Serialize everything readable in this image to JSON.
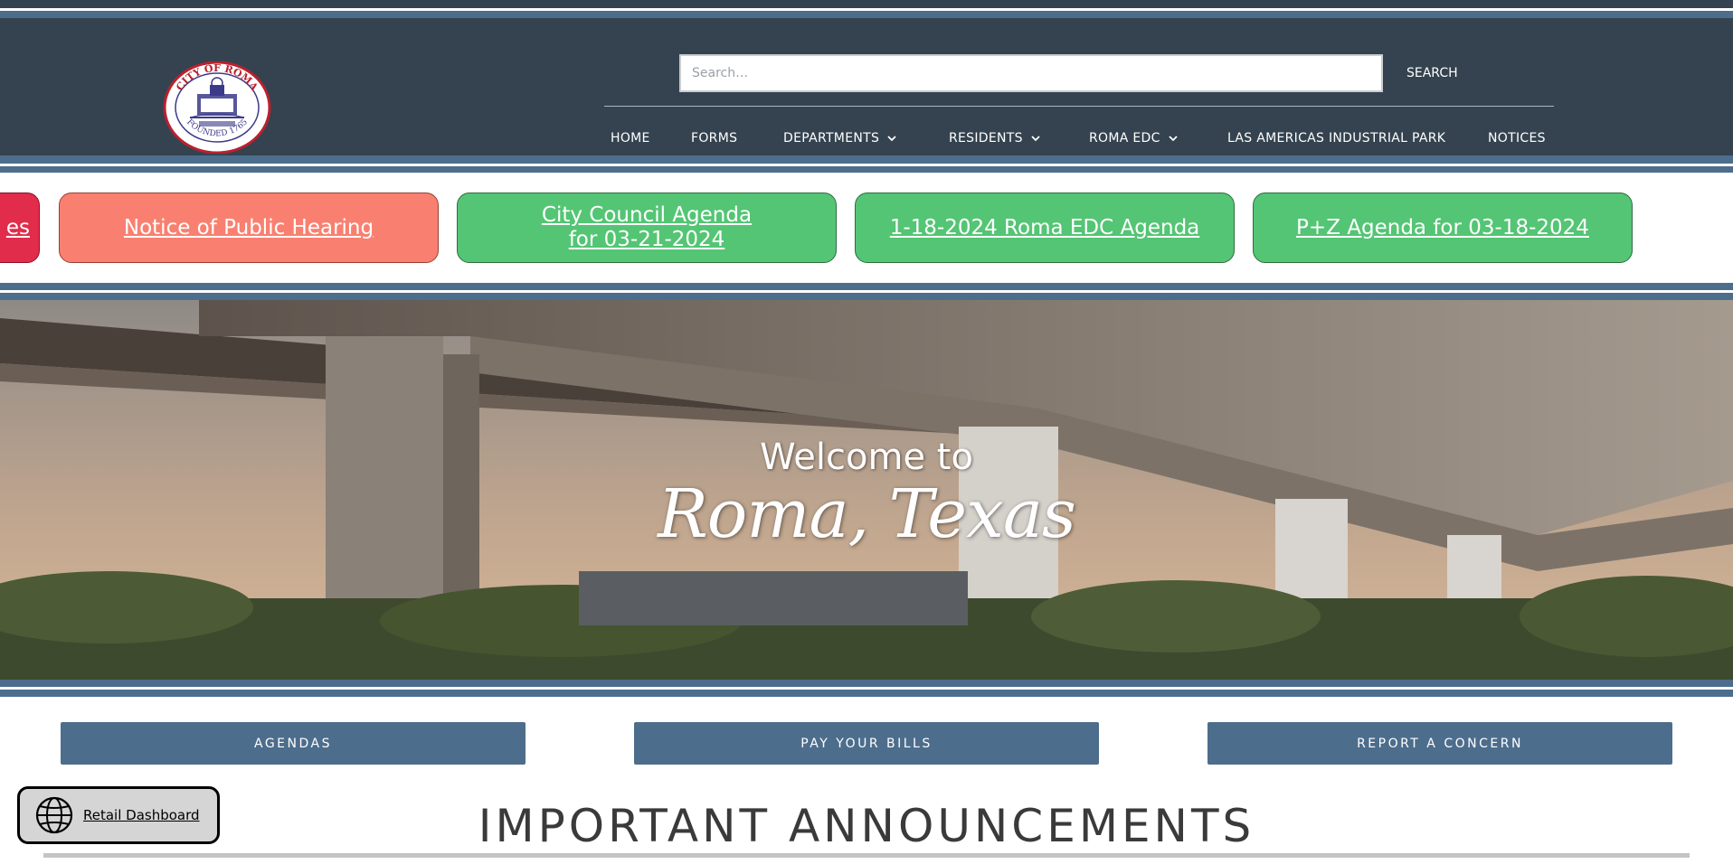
{
  "colors": {
    "header_bg": "#34434f",
    "stripe_blue": "#4d6d8c",
    "notice_red": "#f98070",
    "notice_green": "#54c574",
    "notice_crimson": "#e12c4c",
    "action_button": "#4d6d8c"
  },
  "header": {
    "logo": {
      "text_top": "CITY OF ROMA",
      "text_bottom": "FOUNDED 1765",
      "icon": "city-seal"
    },
    "search": {
      "placeholder": "Search…",
      "value": "",
      "button_label": "SEARCH"
    },
    "nav": [
      {
        "label": "HOME",
        "has_dropdown": false
      },
      {
        "label": "FORMS",
        "has_dropdown": false
      },
      {
        "label": "DEPARTMENTS",
        "has_dropdown": true
      },
      {
        "label": "RESIDENTS",
        "has_dropdown": true
      },
      {
        "label": "ROMA EDC",
        "has_dropdown": true
      },
      {
        "label": "LAS AMERICAS INDUSTRIAL PARK",
        "has_dropdown": false
      },
      {
        "label": "NOTICES",
        "has_dropdown": false
      }
    ]
  },
  "notices": [
    {
      "label": "es",
      "style": "crimson"
    },
    {
      "label": "Notice of Public Hearing",
      "style": "red"
    },
    {
      "label": "City Council Agenda for 03-21-2024",
      "style": "green"
    },
    {
      "label": "1-18-2024 Roma EDC Agenda",
      "style": "green"
    },
    {
      "label": "P+Z Agenda for 03-18-2024",
      "style": "green"
    }
  ],
  "hero": {
    "line1": "Welcome to",
    "line2": "Roma, Texas"
  },
  "actions": [
    {
      "label": "AGENDAS"
    },
    {
      "label": "PAY YOUR BILLS"
    },
    {
      "label": "REPORT A CONCERN"
    }
  ],
  "retail_dashboard": {
    "label": "Retail Dashboard",
    "icon": "globe-icon"
  },
  "announcements": {
    "title": "IMPORTANT ANNOUNCEMENTS"
  }
}
